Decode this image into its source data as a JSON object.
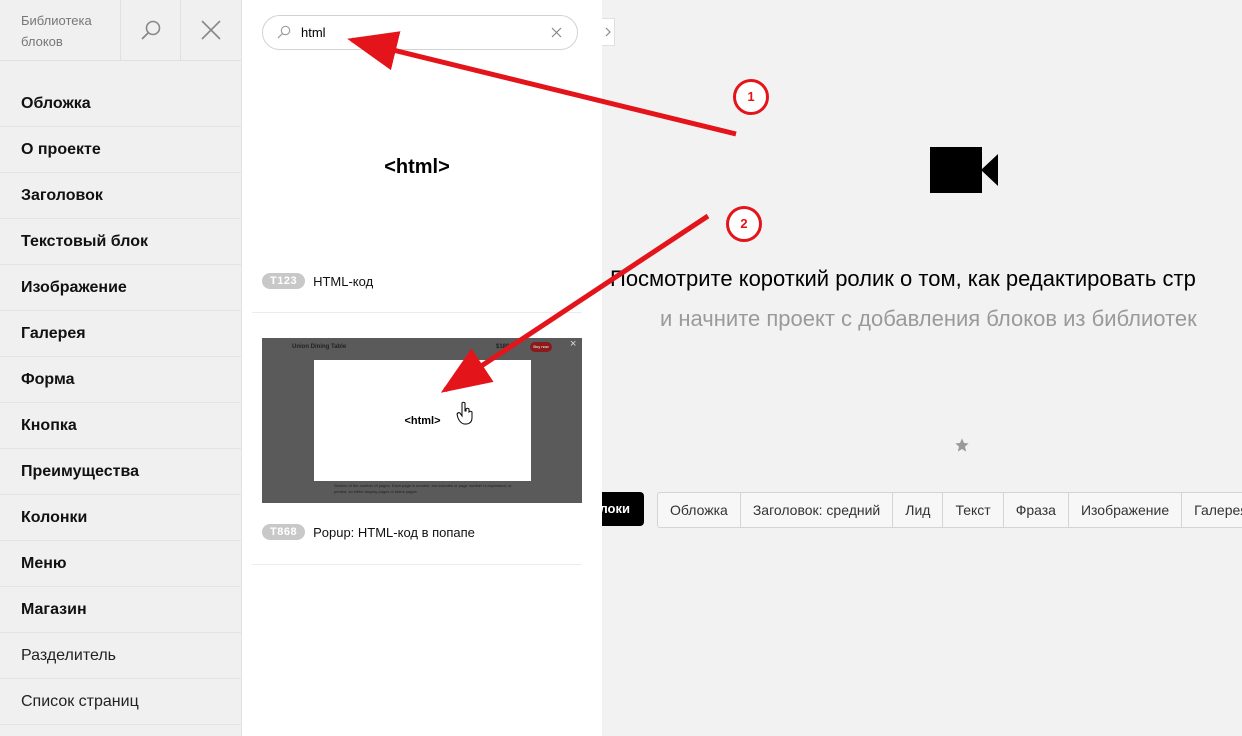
{
  "sidebar": {
    "title": "Библиотека блоков",
    "categories": [
      {
        "label": "Обложка"
      },
      {
        "label": "О проекте"
      },
      {
        "label": "Заголовок"
      },
      {
        "label": "Текстовый блок"
      },
      {
        "label": "Изображение"
      },
      {
        "label": "Галерея"
      },
      {
        "label": "Форма"
      },
      {
        "label": "Кнопка"
      },
      {
        "label": "Преимущества"
      },
      {
        "label": "Колонки"
      },
      {
        "label": "Меню"
      },
      {
        "label": "Магазин"
      },
      {
        "label": "Разделитель"
      },
      {
        "label": "Список страниц"
      }
    ]
  },
  "search": {
    "value": "html",
    "placeholder": ""
  },
  "results": [
    {
      "preview_text": "<html>",
      "code": "T123",
      "name": "HTML-код"
    },
    {
      "code": "T868",
      "name": "Popup: HTML-код в попапе",
      "thumb": {
        "title": "Union Dining Table",
        "price": "$180",
        "button": "Buy now",
        "html": "<html>",
        "footer": "Section of the number of pages. Each page is created, but includes or page number is expressed, or printed, so either display pages or blank pages"
      }
    }
  ],
  "editor": {
    "hint_title": "Посмотрите короткий ролик о том, как редактировать стр",
    "hint_subtitle": "и начните проект с добавления блоков из библиотек",
    "all_blocks_label": "локи",
    "tags": [
      "Обложка",
      "Заголовок: средний",
      "Лид",
      "Текст",
      "Фраза",
      "Изображение",
      "Галерея"
    ]
  },
  "annotations": [
    {
      "number": "1"
    },
    {
      "number": "2"
    }
  ],
  "colors": {
    "annotation": "#e4141b",
    "badge": "#c8c8c8",
    "thumb_bg": "#5a5a5a",
    "popup_button": "#8b1a1a"
  }
}
